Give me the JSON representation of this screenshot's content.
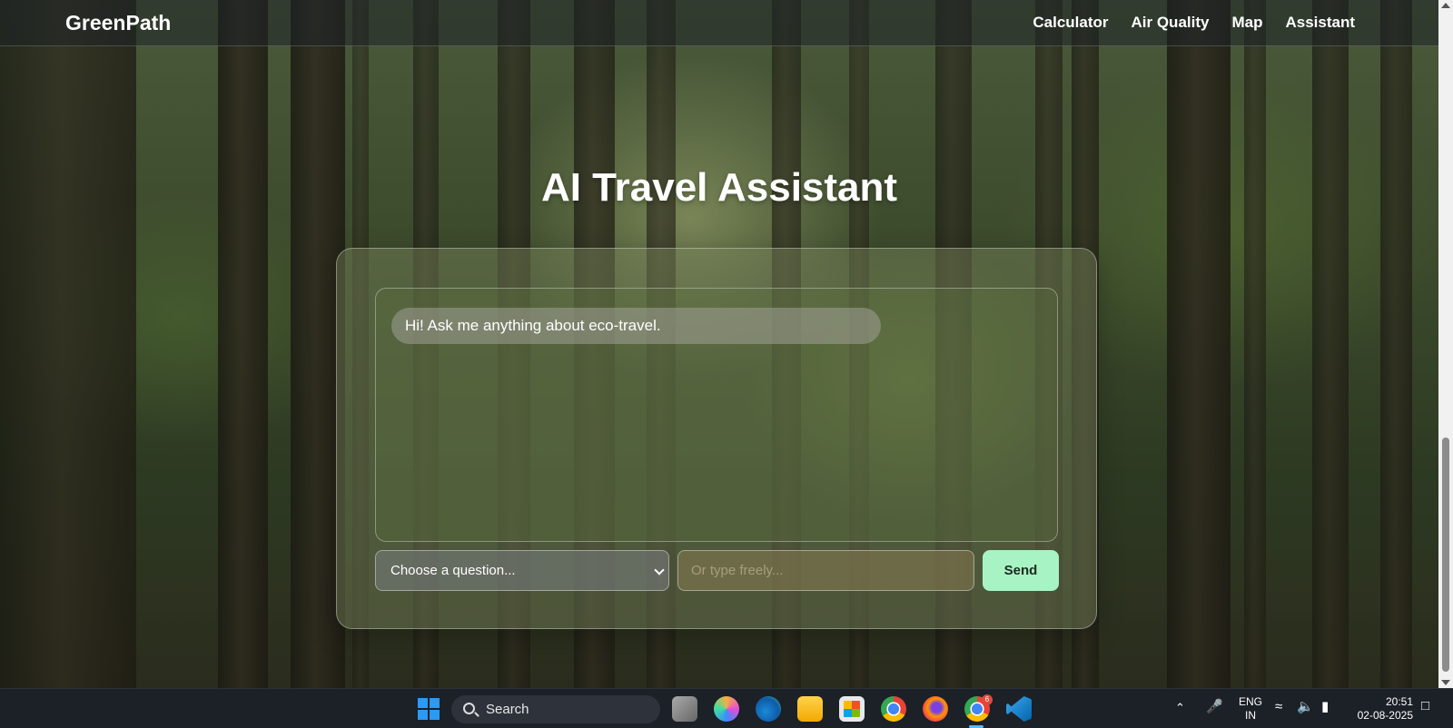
{
  "navbar": {
    "brand": "GreenPath",
    "links": [
      "Calculator",
      "Air Quality",
      "Map",
      "Assistant"
    ]
  },
  "page": {
    "title": "AI Travel Assistant"
  },
  "chat": {
    "messages": [
      {
        "from": "bot",
        "text": "Hi! Ask me anything about eco-travel."
      }
    ],
    "select_placeholder": "Choose a question...",
    "input_placeholder": "Or type freely...",
    "send_label": "Send"
  },
  "colors": {
    "send_button": "#a8f3c4",
    "accent": "#2b9af3"
  },
  "taskbar": {
    "search_label": "Search",
    "apps": [
      "task-view",
      "copilot",
      "edge",
      "file-explorer",
      "microsoft-store",
      "chrome",
      "firefox",
      "chrome-profile",
      "vscode"
    ],
    "badge_count": "6",
    "language": [
      "ENG",
      "IN"
    ],
    "time": "20:51",
    "date": "02-08-2025"
  }
}
